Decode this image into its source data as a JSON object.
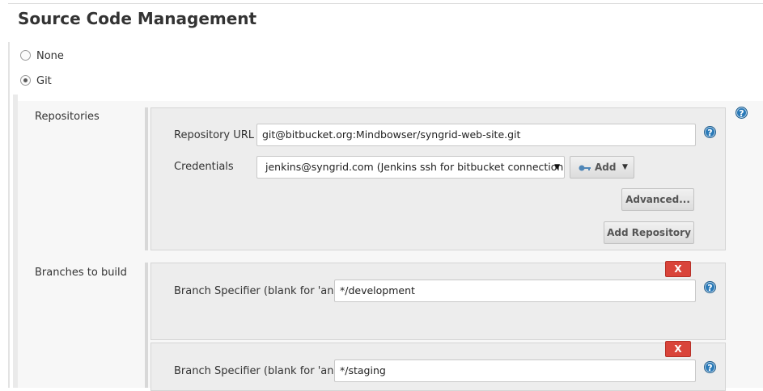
{
  "header": {
    "title": "Source Code Management"
  },
  "scm_options": [
    {
      "label": "None",
      "checked": false
    },
    {
      "label": "Git",
      "checked": true
    }
  ],
  "repositories": {
    "label": "Repositories",
    "repo_url_label": "Repository URL",
    "repo_url_value": "git@bitbucket.org:Mindbowser/syngrid-web-site.git",
    "credentials_label": "Credentials",
    "credentials_value": "jenkins@syngrid.com (Jenkins ssh for bitbucket connection)",
    "add_button_label": "Add",
    "advanced_button_label": "Advanced...",
    "add_repository_label": "Add Repository"
  },
  "branches": {
    "label": "Branches to build",
    "items": [
      {
        "specifier_label": "Branch Specifier (blank for 'any')",
        "value": "*/development",
        "delete_label": "X"
      },
      {
        "specifier_label": "Branch Specifier (blank for 'any')",
        "value": "*/staging",
        "delete_label": "X"
      }
    ]
  },
  "help_glyph": "?",
  "icons": {
    "help": "help-icon",
    "key": "key-icon",
    "dropdown": "chevron-down-icon"
  },
  "colors": {
    "help_icon": "#2a7ab8",
    "delete_button": "#d9443a",
    "panel_bg": "#ededed"
  }
}
